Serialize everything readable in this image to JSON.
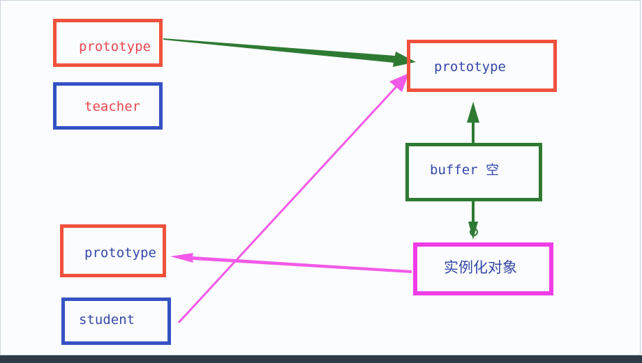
{
  "boxes": {
    "prototype_top_left": "prototype",
    "teacher": "teacher",
    "prototype_top_right": "prototype",
    "buffer": "buffer 空",
    "prototype_bottom_left": "prototype",
    "instance": "实例化对象",
    "student": "student"
  },
  "colors": {
    "red_border": "#f0513c",
    "blue_border": "#3552c4",
    "green_border": "#2e7a33",
    "pink_border": "#ef3de6",
    "red_text": "#e8464e",
    "blue_text": "#3447a8",
    "green_arrow": "#2e7a33",
    "pink_arrow": "#f25ae8"
  },
  "arrows": [
    {
      "from": "prototype_top_left",
      "to": "prototype_top_right",
      "color": "green"
    },
    {
      "from": "buffer",
      "to": "prototype_top_right",
      "color": "green"
    },
    {
      "from": "buffer",
      "to": "instance",
      "color": "green"
    },
    {
      "from": "instance",
      "to": "prototype_bottom_left",
      "color": "pink"
    },
    {
      "from": "student",
      "to": "prototype_top_right",
      "color": "pink"
    }
  ]
}
